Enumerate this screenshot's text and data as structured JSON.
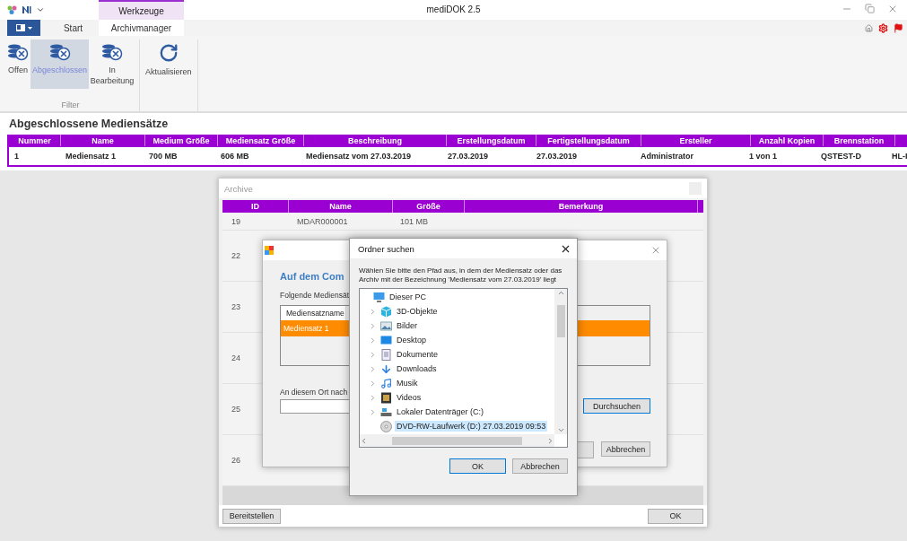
{
  "app": {
    "title": "mediDOK 2.5",
    "context_group": "Werkzeuge"
  },
  "ribbon_tabs": [
    {
      "label": "Start",
      "selected": false
    },
    {
      "label": "Archivmanager",
      "selected": true
    }
  ],
  "ribbon_buttons": [
    {
      "label": "Offen",
      "kind": "filter",
      "selected": false
    },
    {
      "label": "Abgeschlossen",
      "kind": "filter",
      "selected": true
    },
    {
      "label": "In Bearbeitung",
      "kind": "filter",
      "selected": false
    },
    {
      "label": "Aktualisieren",
      "kind": "refresh",
      "selected": false
    }
  ],
  "ribbon_group_label": "Filter",
  "section_title": "Abgeschlossene Mediensätze",
  "table": {
    "columns": [
      "Nummer",
      "Name",
      "Medium Größe",
      "Mediensatz Größe",
      "Beschreibung",
      "Erstellungsdatum",
      "Fertigstellungsdatum",
      "Ersteller",
      "Anzahl Kopien",
      "Brennstation"
    ],
    "rows": [
      {
        "cells": [
          "1",
          "Mediensatz 1",
          "700 MB",
          "606 MB",
          "Mediensatz vom 27.03.2019",
          "27.03.2019",
          "27.03.2019",
          "Administrator",
          "1 von 1",
          "QSTEST-D",
          "HL-I"
        ],
        "selected": true
      }
    ]
  },
  "archive_window": {
    "title": "Archive",
    "columns": [
      "ID",
      "Name",
      "Größe",
      "Bemerkung"
    ],
    "rows": [
      {
        "cells": [
          "19",
          "MDAR000001",
          "101 MB"
        ]
      },
      {
        "cells": [
          "22"
        ]
      },
      {
        "cells": [
          "23"
        ]
      },
      {
        "cells": [
          "24"
        ]
      },
      {
        "cells": [
          "25"
        ]
      },
      {
        "cells": [
          "26"
        ]
      }
    ],
    "left_button": "Bereitstellen",
    "right_button": "OK"
  },
  "media_dialog": {
    "heading": "Auf dem Com",
    "list_label": "Folgende Mediensät",
    "list_column": "Mediensatzname",
    "list_rows": [
      {
        "label": "Mediensatz 1",
        "selected": true
      }
    ],
    "location_label": "An diesem Ort nach",
    "browse_button": "Durchsuchen",
    "cancel_button": "Abbrechen"
  },
  "folder_dialog": {
    "title": "Ordner suchen",
    "description": "Wählen Sie bitte den Pfad aus, in dem der Mediensatz oder das Archiv mit der Bezeichnung 'Mediensatz vom 27.03.2019' liegt",
    "tree": [
      {
        "label": "Dieser PC",
        "kind": "pc",
        "expandable": false,
        "selected": false,
        "children": [
          {
            "label": "3D-Objekte",
            "kind": "cube",
            "expandable": true,
            "selected": false
          },
          {
            "label": "Bilder",
            "kind": "pictures",
            "expandable": true,
            "selected": false
          },
          {
            "label": "Desktop",
            "kind": "desktop",
            "expandable": true,
            "selected": false
          },
          {
            "label": "Dokumente",
            "kind": "documents",
            "expandable": true,
            "selected": false
          },
          {
            "label": "Downloads",
            "kind": "downloads",
            "expandable": true,
            "selected": false
          },
          {
            "label": "Musik",
            "kind": "music",
            "expandable": true,
            "selected": false
          },
          {
            "label": "Videos",
            "kind": "videos",
            "expandable": true,
            "selected": false
          },
          {
            "label": "Lokaler Datenträger (C:)",
            "kind": "drive",
            "expandable": true,
            "selected": false
          },
          {
            "label": "DVD-RW-Laufwerk (D:) 27.03.2019 09:53",
            "kind": "disc",
            "expandable": false,
            "selected": true
          }
        ]
      }
    ],
    "ok_button": "OK",
    "cancel_button": "Abbrechen"
  }
}
